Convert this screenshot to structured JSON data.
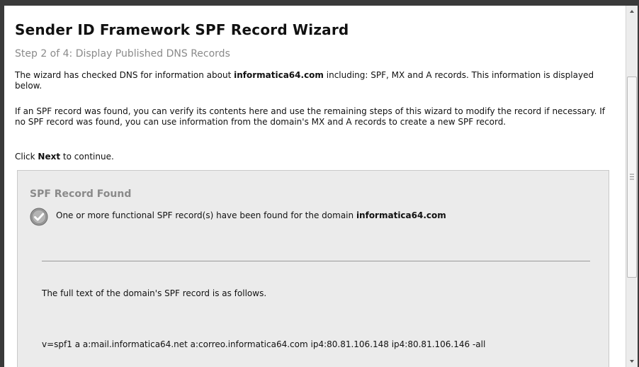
{
  "wizard": {
    "title": "Sender ID Framework SPF Record Wizard",
    "step": "Step 2 of 4: Display Published DNS Records",
    "intro": {
      "prefix": "The wizard has checked DNS for information about ",
      "domain": "informatica64.com",
      "suffix": "  including: SPF, MX and A records. This information is displayed below."
    },
    "explanation": "If an SPF record was found, you can verify its contents here and use the remaining steps of this wizard to modify the record if necessary. If no SPF record was found, you can use information from the domain's MX and A records to create a new SPF record.",
    "instruction": {
      "prefix": "Click ",
      "emphasis": "Next",
      "suffix": " to continue."
    }
  },
  "spf_panel": {
    "title": "SPF Record Found",
    "status_icon": "check-circle-icon",
    "found_message": "One or more functional SPF record(s) have been found for the domain ",
    "found_domain": "informatica64.com",
    "full_text_label": "The full text of the domain's SPF record is as follows.",
    "record": "v=spf1 a a:mail.informatica64.net a:correo.informatica64.com ip4:80.81.106.148 ip4:80.81.106.146 -all"
  },
  "scrollbar": {
    "up_icon": "scroll-up-arrow-icon",
    "down_icon": "scroll-down-arrow-icon",
    "grip_icon": "scroll-grip-icon"
  },
  "colors": {
    "panel_background": "#ebebeb",
    "muted_heading": "#8a8a8a",
    "body_text": "#111111"
  }
}
